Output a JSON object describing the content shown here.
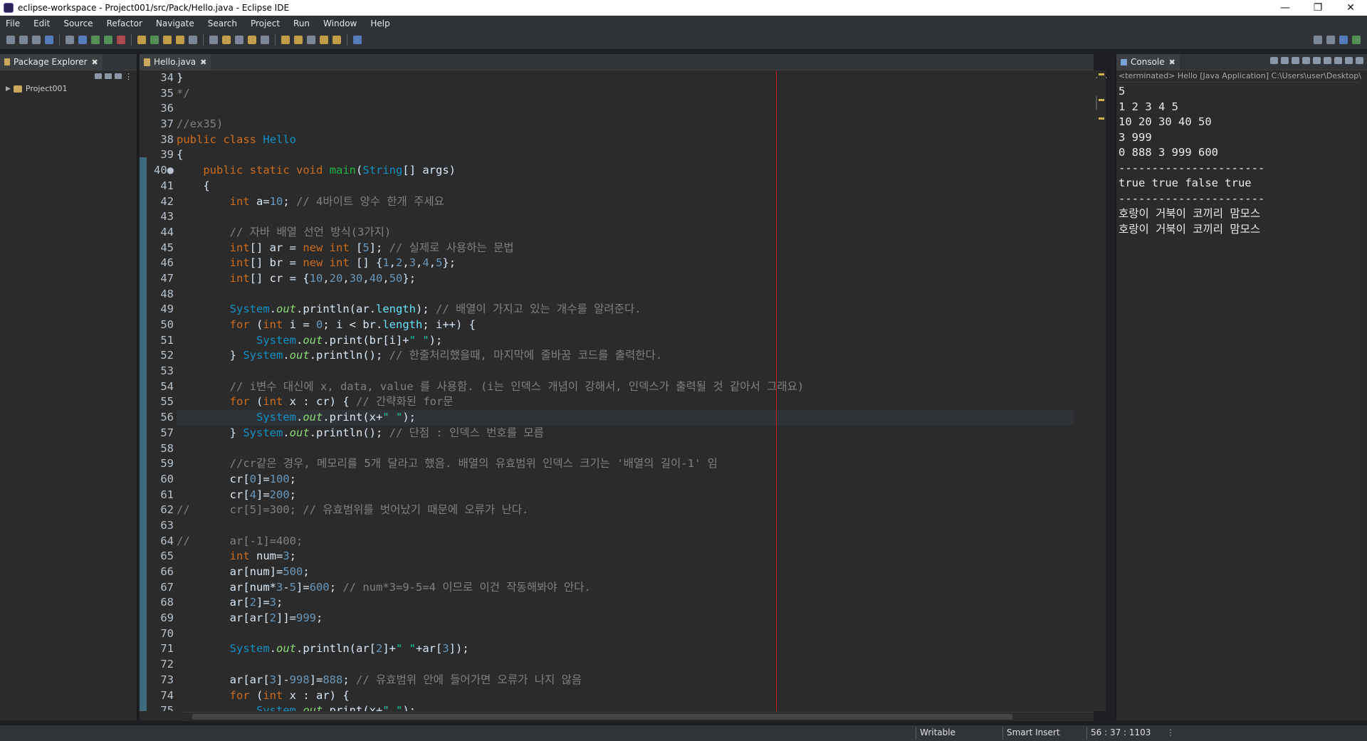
{
  "window": {
    "title": "eclipse-workspace - Project001/src/Pack/Hello.java - Eclipse IDE"
  },
  "menu": [
    "File",
    "Edit",
    "Source",
    "Refactor",
    "Navigate",
    "Search",
    "Project",
    "Run",
    "Window",
    "Help"
  ],
  "package_explorer": {
    "tab_label": "Package Explorer",
    "project": "Project001"
  },
  "editor": {
    "tab_label": "Hello.java",
    "lines": [
      {
        "n": "34",
        "c": "}"
      },
      {
        "n": "35",
        "c": "*/"
      },
      {
        "n": "36",
        "c": ""
      },
      {
        "n": "37",
        "c": "//ex35)"
      },
      {
        "n": "38",
        "c": "public class Hello"
      },
      {
        "n": "39",
        "c": "{"
      },
      {
        "n": "40",
        "c": "    public static void main(String[] args)"
      },
      {
        "n": "41",
        "c": "    {"
      },
      {
        "n": "42",
        "c": "        int a=10; // 4바이트 양수 한개 주세요"
      },
      {
        "n": "43",
        "c": ""
      },
      {
        "n": "44",
        "c": "        // 자바 배열 선언 방식(3가지)"
      },
      {
        "n": "45",
        "c": "        int[] ar = new int [5]; // 실제로 사용하는 문법"
      },
      {
        "n": "46",
        "c": "        int[] br = new int [] {1,2,3,4,5};"
      },
      {
        "n": "47",
        "c": "        int[] cr = {10,20,30,40,50};"
      },
      {
        "n": "48",
        "c": ""
      },
      {
        "n": "49",
        "c": "        System.out.println(ar.length); // 배열이 가지고 있는 개수를 알려준다."
      },
      {
        "n": "50",
        "c": "        for (int i = 0; i < br.length; i++) {"
      },
      {
        "n": "51",
        "c": "            System.out.print(br[i]+\" \");"
      },
      {
        "n": "52",
        "c": "        } System.out.println(); // 한줄처리했을때, 마지막에 줄바꿈 코드를 출력한다."
      },
      {
        "n": "53",
        "c": ""
      },
      {
        "n": "54",
        "c": "        // i변수 대신에 x, data, value 를 사용함. (i는 인덱스 개념이 강해서, 인덱스가 출력될 것 같아서 그래요)"
      },
      {
        "n": "55",
        "c": "        for (int x : cr) { // 간략화된 for문"
      },
      {
        "n": "56",
        "c": "            System.out.print(x+\" \");"
      },
      {
        "n": "57",
        "c": "        } System.out.println(); // 단점 : 인덱스 번호를 모름"
      },
      {
        "n": "58",
        "c": ""
      },
      {
        "n": "59",
        "c": "        //cr같은 경우, 메모리를 5개 달라고 했음. 배열의 유효범위 인덱스 크기는 '배열의 길이-1' 임"
      },
      {
        "n": "60",
        "c": "        cr[0]=100;"
      },
      {
        "n": "61",
        "c": "        cr[4]=200;"
      },
      {
        "n": "62",
        "c": "//      cr[5]=300; // 유효범위를 벗어났기 때문에 오류가 난다."
      },
      {
        "n": "63",
        "c": ""
      },
      {
        "n": "64",
        "c": "//      ar[-1]=400;"
      },
      {
        "n": "65",
        "c": "        int num=3;"
      },
      {
        "n": "66",
        "c": "        ar[num]=500;"
      },
      {
        "n": "67",
        "c": "        ar[num*3-5]=600; // num*3=9-5=4 이므로 이건 작동해봐야 안다."
      },
      {
        "n": "68",
        "c": "        ar[2]=3;"
      },
      {
        "n": "69",
        "c": "        ar[ar[2]]=999;"
      },
      {
        "n": "70",
        "c": ""
      },
      {
        "n": "71",
        "c": "        System.out.println(ar[2]+\" \"+ar[3]);"
      },
      {
        "n": "72",
        "c": ""
      },
      {
        "n": "73",
        "c": "        ar[ar[3]-998]=888; // 유효범위 안에 들어가면 오류가 나지 않음"
      },
      {
        "n": "74",
        "c": "        for (int x : ar) {"
      },
      {
        "n": "75",
        "c": "            System.out.print(x+\" \");"
      }
    ]
  },
  "console": {
    "tab_label": "Console",
    "header": "<terminated> Hello [Java Application] C:\\Users\\user\\Desktop\\",
    "output": [
      "5",
      "1 2 3 4 5",
      "10 20 30 40 50",
      "3 999",
      "0 888 3 999 600",
      "----------------------",
      "true true false true",
      "----------------------",
      "호랑이 거북이 코끼리 맘모스",
      "호랑이 거북이 코끼리 맘모스"
    ]
  },
  "status": {
    "writable": "Writable",
    "insert_mode": "Smart Insert",
    "position": "56 : 37 : 1103"
  }
}
